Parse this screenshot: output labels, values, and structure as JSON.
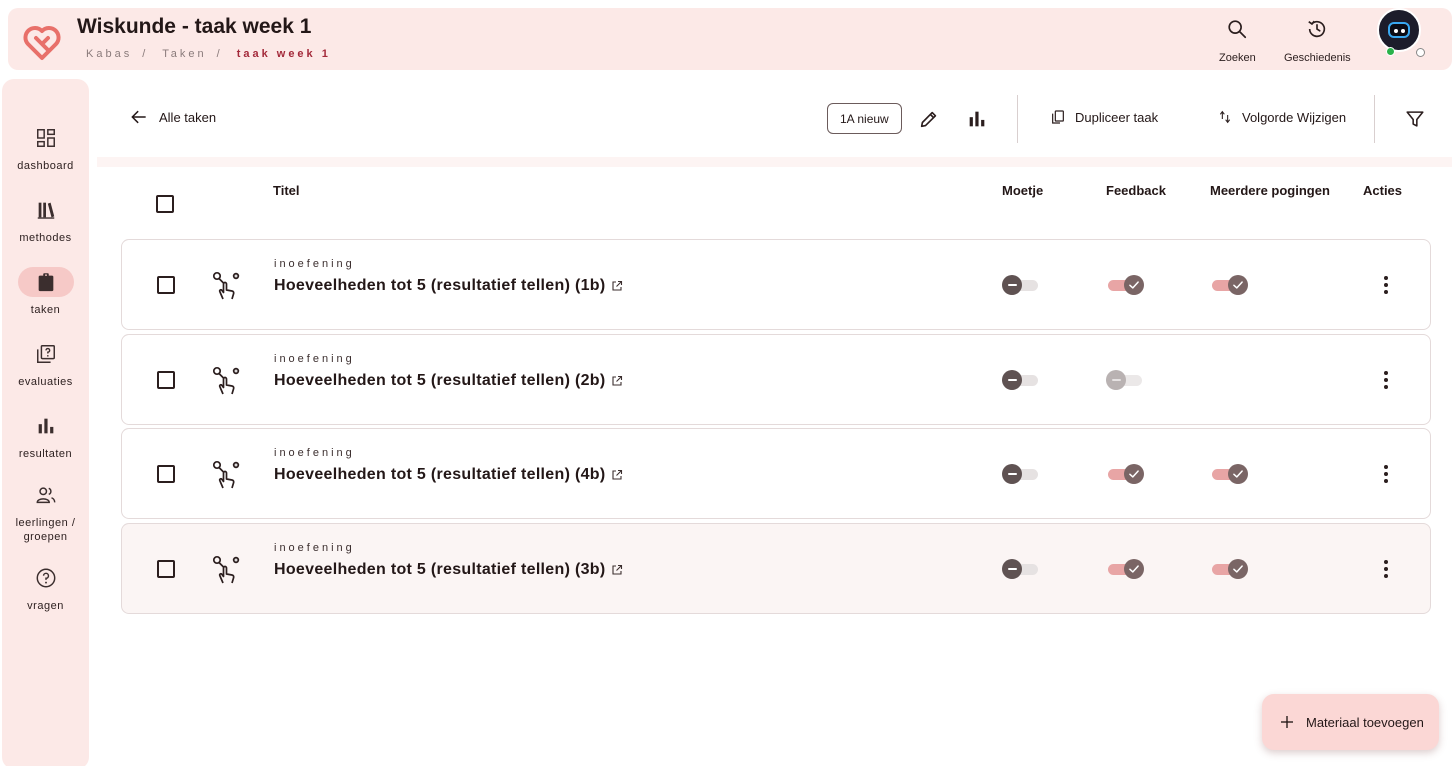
{
  "header": {
    "title": "Wiskunde - taak week 1",
    "breadcrumb": [
      "Kabas",
      "Taken",
      "taak week 1"
    ],
    "search_label": "Zoeken",
    "history_label": "Geschiedenis"
  },
  "sidebar": {
    "items": [
      {
        "label": "dashboard",
        "icon": "dashboard-icon"
      },
      {
        "label": "methodes",
        "icon": "books-icon"
      },
      {
        "label": "taken",
        "icon": "clipboard-icon",
        "active": true
      },
      {
        "label": "evaluaties",
        "icon": "quiz-icon"
      },
      {
        "label": "resultaten",
        "icon": "bar-chart-icon"
      },
      {
        "label": "leerlingen /",
        "label2": "groepen",
        "icon": "people-icon"
      },
      {
        "label": "vragen",
        "icon": "help-icon"
      }
    ]
  },
  "toolbar": {
    "back_label": "Alle taken",
    "class_chip": "1A nieuw",
    "duplicate_label": "Dupliceer taak",
    "reorder_label": "Volgorde Wijzigen"
  },
  "table": {
    "columns": {
      "title": "Titel",
      "moetje": "Moetje",
      "feedback": "Feedback",
      "attempts": "Meerdere pogingen",
      "actions": "Acties"
    },
    "rows": [
      {
        "kind": "inoefening",
        "title": "Hoeveelheden tot 5 (resultatief tellen) (1b)",
        "moetje": false,
        "feedback": true,
        "attempts": true
      },
      {
        "kind": "inoefening",
        "title": "Hoeveelheden tot 5 (resultatief tellen) (2b)",
        "moetje": false,
        "feedback": "disabled",
        "attempts": null
      },
      {
        "kind": "inoefening",
        "title": "Hoeveelheden tot 5 (resultatief tellen) (4b)",
        "moetje": false,
        "feedback": true,
        "attempts": true
      },
      {
        "kind": "inoefening",
        "title": "Hoeveelheden tot 5 (resultatief tellen) (3b)",
        "moetje": false,
        "feedback": true,
        "attempts": true
      }
    ]
  },
  "fab": {
    "label": "Materiaal toevoegen"
  },
  "colors": {
    "accent": "#a3293a",
    "panel": "#fce9e7",
    "toggle_on": "#e8a5a5",
    "fab": "#fbd7d5"
  }
}
